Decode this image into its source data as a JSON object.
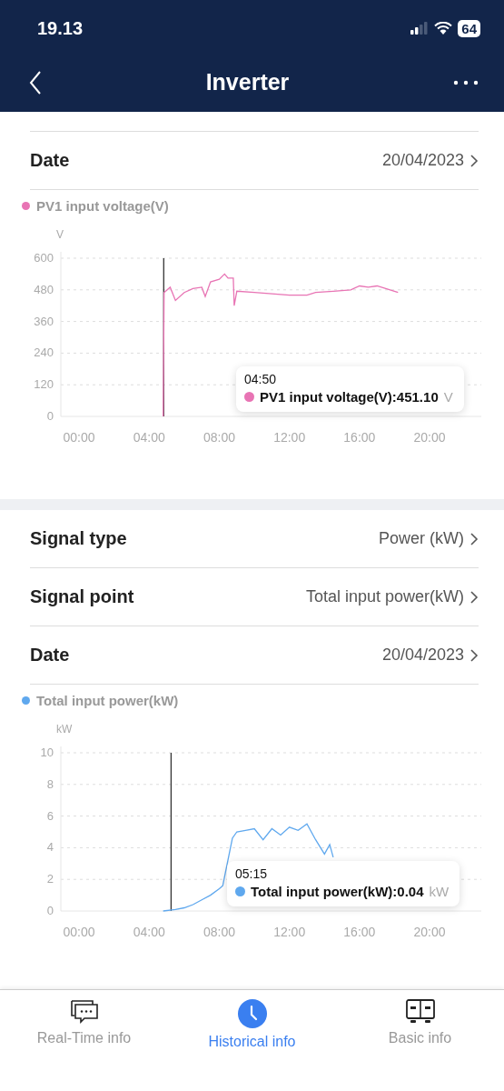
{
  "status_bar": {
    "time": "19.13",
    "battery": "64"
  },
  "header": {
    "title": "Inverter"
  },
  "sections": [
    {
      "rows": [
        {
          "label": "Date",
          "value": "20/04/2023"
        }
      ],
      "chart": {
        "tooltip": {
          "time": "04:50",
          "text": "PV1 input voltage(V):451.10",
          "unit": "V"
        },
        "chart_data": {
          "type": "line",
          "grid": true,
          "ylabel": "V",
          "ylim": [
            0,
            600
          ],
          "yticks": [
            0,
            120,
            240,
            360,
            480,
            600
          ],
          "xlim": [
            -1.04,
            22.95
          ],
          "xticks": [
            {
              "value": 0,
              "label": "00:00"
            },
            {
              "value": 4,
              "label": "04:00"
            },
            {
              "value": 8,
              "label": "08:00"
            },
            {
              "value": 12,
              "label": "12:00"
            },
            {
              "value": 16,
              "label": "16:00"
            },
            {
              "value": 20,
              "label": "20:00"
            }
          ],
          "x": [
            4.8,
            4.85,
            5.2,
            5.5,
            6,
            6.5,
            7,
            7.2,
            7.5,
            8,
            8.3,
            8.5,
            8.8,
            8.85,
            9,
            10,
            11,
            12,
            13,
            13.5,
            14.5,
            15.5,
            16,
            16.5,
            17,
            17.5,
            18.2
          ],
          "series": [
            {
              "name": "PV1 input voltage(V)",
              "color": "#e874b4",
              "values": [
                0,
                470,
                490,
                440,
                470,
                485,
                490,
                455,
                510,
                520,
                540,
                525,
                525,
                420,
                475,
                470,
                465,
                460,
                460,
                470,
                475,
                480,
                495,
                490,
                495,
                485,
                470
              ]
            }
          ],
          "ref_lines": [
            {
              "axis": "x",
              "value": 4.83
            }
          ]
        }
      }
    },
    {
      "rows": [
        {
          "label": "Signal type",
          "value": "Power (kW)"
        },
        {
          "label": "Signal point",
          "value": "Total input power(kW)"
        },
        {
          "label": "Date",
          "value": "20/04/2023"
        }
      ],
      "chart": {
        "tooltip": {
          "time": "05:15",
          "text": "Total input power(kW):0.04",
          "unit": "kW"
        },
        "chart_data": {
          "type": "line",
          "grid": true,
          "ylabel": "kW",
          "ylim": [
            0,
            10
          ],
          "yticks": [
            0,
            2,
            4,
            6,
            8,
            10
          ],
          "xlim": [
            -1.04,
            22.95
          ],
          "xticks": [
            {
              "value": 0,
              "label": "00:00"
            },
            {
              "value": 4,
              "label": "04:00"
            },
            {
              "value": 8,
              "label": "08:00"
            },
            {
              "value": 12,
              "label": "12:00"
            },
            {
              "value": 16,
              "label": "16:00"
            },
            {
              "value": 20,
              "label": "20:00"
            }
          ],
          "x": [
            4.8,
            5.5,
            6,
            6.5,
            7,
            7.5,
            8,
            8.2,
            8.75,
            9,
            9.5,
            10,
            10.5,
            11,
            11.5,
            12,
            12.5,
            13,
            13.5,
            14,
            14.3,
            14.5
          ],
          "series": [
            {
              "name": "Total input power(kW)",
              "color": "#5fa8ee",
              "values": [
                0,
                0.1,
                0.2,
                0.4,
                0.7,
                1,
                1.4,
                1.6,
                4.6,
                5,
                5.1,
                5.2,
                4.5,
                5.2,
                4.8,
                5.3,
                5.1,
                5.5,
                4.5,
                3.6,
                4.2,
                3.4
              ]
            }
          ],
          "ref_lines": [
            {
              "axis": "x",
              "value": 5.25
            }
          ]
        }
      }
    }
  ],
  "tab_bar": [
    {
      "label": "Real-Time info",
      "kind": "chat",
      "selected": false
    },
    {
      "label": "Historical info",
      "kind": "clock",
      "selected": true
    },
    {
      "label": "Basic info",
      "kind": "cabinet",
      "selected": false
    }
  ]
}
